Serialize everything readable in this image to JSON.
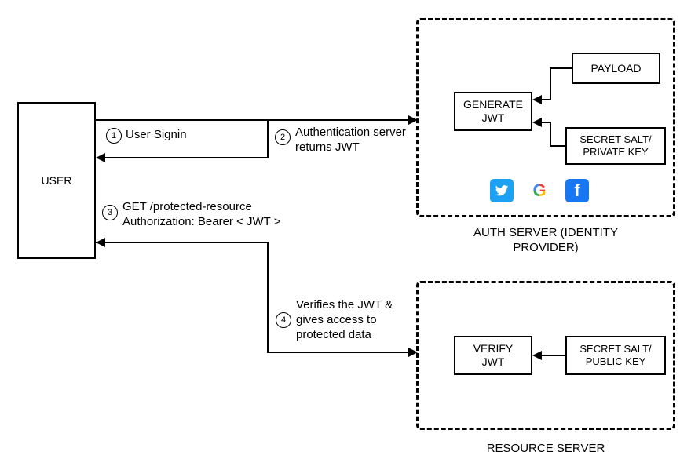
{
  "user_box": {
    "label": "USER"
  },
  "auth_server": {
    "title": "AUTH SERVER (IDENTITY PROVIDER)",
    "generate_box": "GENERATE\nJWT",
    "payload_box": "PAYLOAD",
    "key_box": "SECRET SALT/\nPRIVATE KEY",
    "providers": [
      "twitter",
      "google",
      "facebook"
    ]
  },
  "resource_server": {
    "title": "RESOURCE SERVER",
    "verify_box": "VERIFY\nJWT",
    "key_box": "SECRET SALT/\nPUBLIC KEY"
  },
  "steps": {
    "s1": {
      "num": "1",
      "text": "User Signin"
    },
    "s2": {
      "num": "2",
      "text": "Authentication server\nreturns JWT"
    },
    "s3": {
      "num": "3",
      "text": "GET /protected-resource\nAuthorization: Bearer  < JWT >"
    },
    "s4": {
      "num": "4",
      "text": "Verifies the JWT &\ngives access to\nprotected data"
    }
  }
}
